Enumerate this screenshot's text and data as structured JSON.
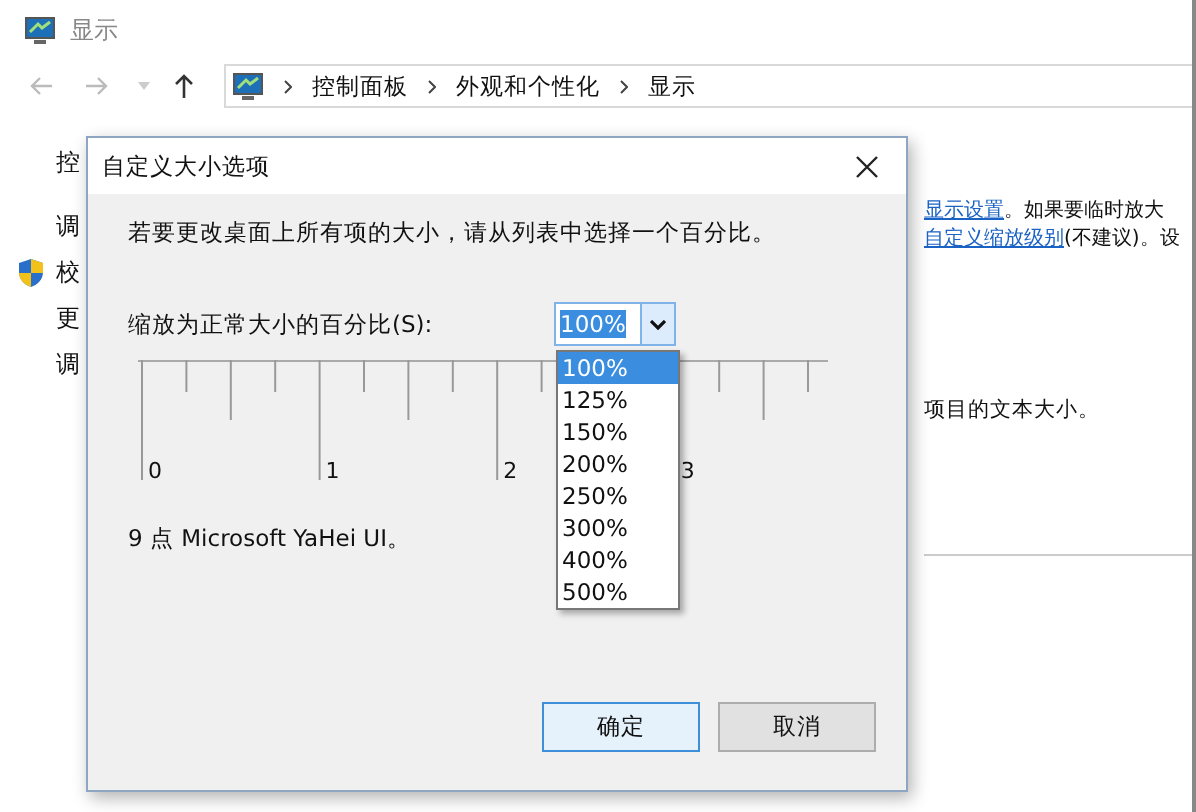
{
  "window": {
    "title": "显示"
  },
  "address_bar": {
    "breadcrumbs": [
      "控制面板",
      "外观和个性化",
      "显示"
    ]
  },
  "content": {
    "left_items": [
      {
        "text": "控",
        "shield": false
      },
      {
        "text": "调",
        "shield": false
      },
      {
        "text": "校",
        "shield": true
      },
      {
        "text": "更",
        "shield": false
      },
      {
        "text": "调",
        "shield": false
      }
    ],
    "links": [
      {
        "link": "显示设置",
        "text": "。如果要临时放大"
      },
      {
        "link": "自定义缩放级别",
        "text": "(不建议)。设"
      }
    ],
    "note": "项目的文本大小。"
  },
  "dialog": {
    "title": "自定义大小选项",
    "instruction": "若要更改桌面上所有项的大小，请从列表中选择一个百分比。",
    "scale_label": "缩放为正常大小的百分比(S):",
    "combo": {
      "value": "100%",
      "expanded": true,
      "options": [
        {
          "label": "100%",
          "selected": true
        },
        {
          "label": "125%",
          "selected": false
        },
        {
          "label": "150%",
          "selected": false
        },
        {
          "label": "200%",
          "selected": false
        },
        {
          "label": "250%",
          "selected": false
        },
        {
          "label": "300%",
          "selected": false
        },
        {
          "label": "400%",
          "selected": false
        },
        {
          "label": "500%",
          "selected": false
        }
      ]
    },
    "ruler": {
      "labels": [
        "0",
        "1",
        "2",
        "3"
      ]
    },
    "font_info": "9 点 Microsoft YaHei UI。",
    "buttons": [
      {
        "label": "确定",
        "default": true
      },
      {
        "label": "取消",
        "default": false
      }
    ]
  }
}
